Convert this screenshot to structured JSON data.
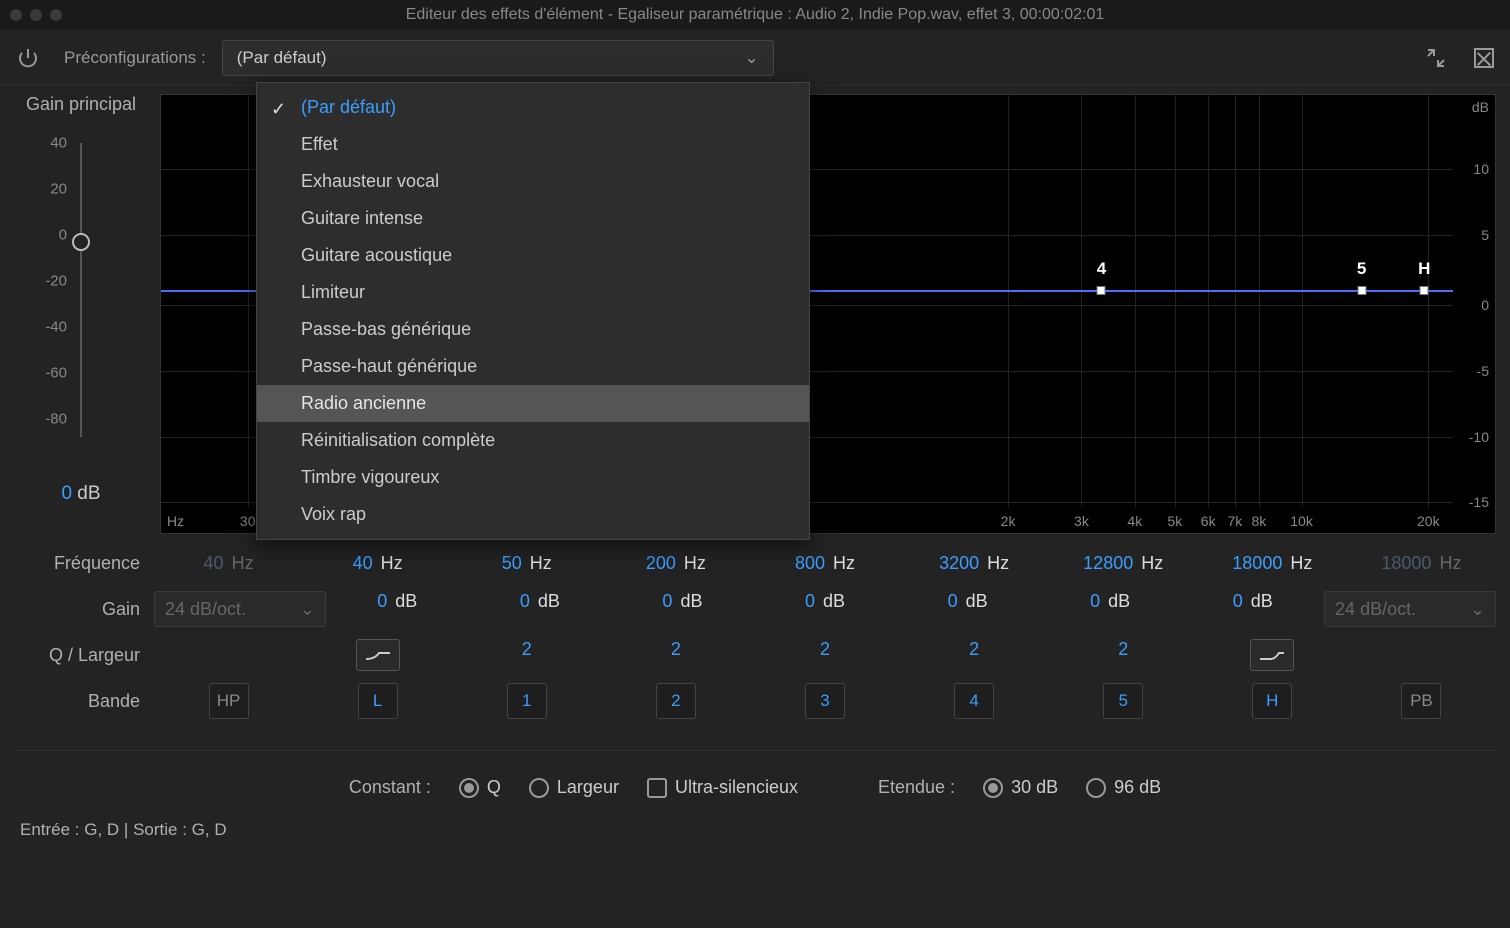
{
  "title": "Editeur des effets d'élément - Egaliseur paramétrique : Audio 2, Indie Pop.wav, effet 3, 00:00:02:01",
  "toolbar": {
    "presets_label": "Préconfigurations :",
    "preset_selected": "(Par défaut)"
  },
  "presets_dropdown": {
    "items": [
      {
        "label": "(Par défaut)",
        "selected": true
      },
      {
        "label": "Effet"
      },
      {
        "label": "Exhausteur vocal"
      },
      {
        "label": "Guitare intense"
      },
      {
        "label": "Guitare acoustique"
      },
      {
        "label": "Limiteur"
      },
      {
        "label": "Passe-bas générique"
      },
      {
        "label": "Passe-haut générique"
      },
      {
        "label": "Radio ancienne",
        "hover": true
      },
      {
        "label": "Réinitialisation complète"
      },
      {
        "label": "Timbre vigoureux"
      },
      {
        "label": "Voix rap"
      }
    ]
  },
  "gain": {
    "label": "Gain principal",
    "ticks": [
      "40",
      "20",
      "0",
      "-20",
      "-40",
      "-60",
      "-80"
    ],
    "value_num": "0",
    "value_unit": " dB"
  },
  "graph": {
    "db_label": "dB",
    "hz_label": "Hz",
    "x_ticks": [
      {
        "label": "30",
        "pct": 6.5
      },
      {
        "label": "2k",
        "pct": 63.5
      },
      {
        "label": "3k",
        "pct": 69
      },
      {
        "label": "4k",
        "pct": 73
      },
      {
        "label": "5k",
        "pct": 76
      },
      {
        "label": "6k",
        "pct": 78.5
      },
      {
        "label": "7k",
        "pct": 80.5
      },
      {
        "label": "8k",
        "pct": 82.3
      },
      {
        "label": "10k",
        "pct": 85.5
      },
      {
        "label": "20k",
        "pct": 95
      }
    ],
    "y_ticks_r": [
      {
        "label": "10",
        "pct": 17
      },
      {
        "label": "5",
        "pct": 32
      },
      {
        "label": "0",
        "pct": 48
      },
      {
        "label": "-5",
        "pct": 63
      },
      {
        "label": "-10",
        "pct": 78
      },
      {
        "label": "-15",
        "pct": 93
      }
    ],
    "points": [
      {
        "label": "4",
        "pct": 70.5
      },
      {
        "label": "5",
        "pct": 90
      },
      {
        "label": "H",
        "pct": 94.7
      }
    ]
  },
  "rows": {
    "freq_label": "Fréquence",
    "gain_label": "Gain",
    "q_label": "Q / Largeur",
    "band_label": "Bande",
    "oct_left": "24 dB/oct.",
    "oct_right": "24 dB/oct."
  },
  "bands": [
    {
      "name": "HP",
      "freq_n": "40",
      "freq_u": " Hz",
      "gain_n": "",
      "gain_u": "",
      "q": "",
      "dim": true,
      "shelf": null
    },
    {
      "name": "L",
      "freq_n": "40",
      "freq_u": " Hz",
      "gain_n": "0",
      "gain_u": " dB",
      "q": "",
      "dim": false,
      "shelf": "low"
    },
    {
      "name": "1",
      "freq_n": "50",
      "freq_u": " Hz",
      "gain_n": "0",
      "gain_u": " dB",
      "q": "2",
      "dim": false,
      "shelf": null
    },
    {
      "name": "2",
      "freq_n": "200",
      "freq_u": " Hz",
      "gain_n": "0",
      "gain_u": " dB",
      "q": "2",
      "dim": false,
      "shelf": null
    },
    {
      "name": "3",
      "freq_n": "800",
      "freq_u": " Hz",
      "gain_n": "0",
      "gain_u": " dB",
      "q": "2",
      "dim": false,
      "shelf": null
    },
    {
      "name": "4",
      "freq_n": "3200",
      "freq_u": " Hz",
      "gain_n": "0",
      "gain_u": " dB",
      "q": "2",
      "dim": false,
      "shelf": null
    },
    {
      "name": "5",
      "freq_n": "12800",
      "freq_u": " Hz",
      "gain_n": "0",
      "gain_u": " dB",
      "q": "2",
      "dim": false,
      "shelf": null
    },
    {
      "name": "H",
      "freq_n": "18000",
      "freq_u": " Hz",
      "gain_n": "0",
      "gain_u": " dB",
      "q": "",
      "dim": false,
      "shelf": "high"
    },
    {
      "name": "PB",
      "freq_n": "18000",
      "freq_u": " Hz",
      "gain_n": "",
      "gain_u": "",
      "q": "",
      "dim": true,
      "shelf": null
    }
  ],
  "bottom": {
    "constant_label": "Constant :",
    "q_label": "Q",
    "largeur_label": "Largeur",
    "ultra_label": "Ultra-silencieux",
    "etendue_label": "Etendue :",
    "r30_label": "30 dB",
    "r96_label": "96 dB"
  },
  "io_line": "Entrée : G, D | Sortie : G, D"
}
